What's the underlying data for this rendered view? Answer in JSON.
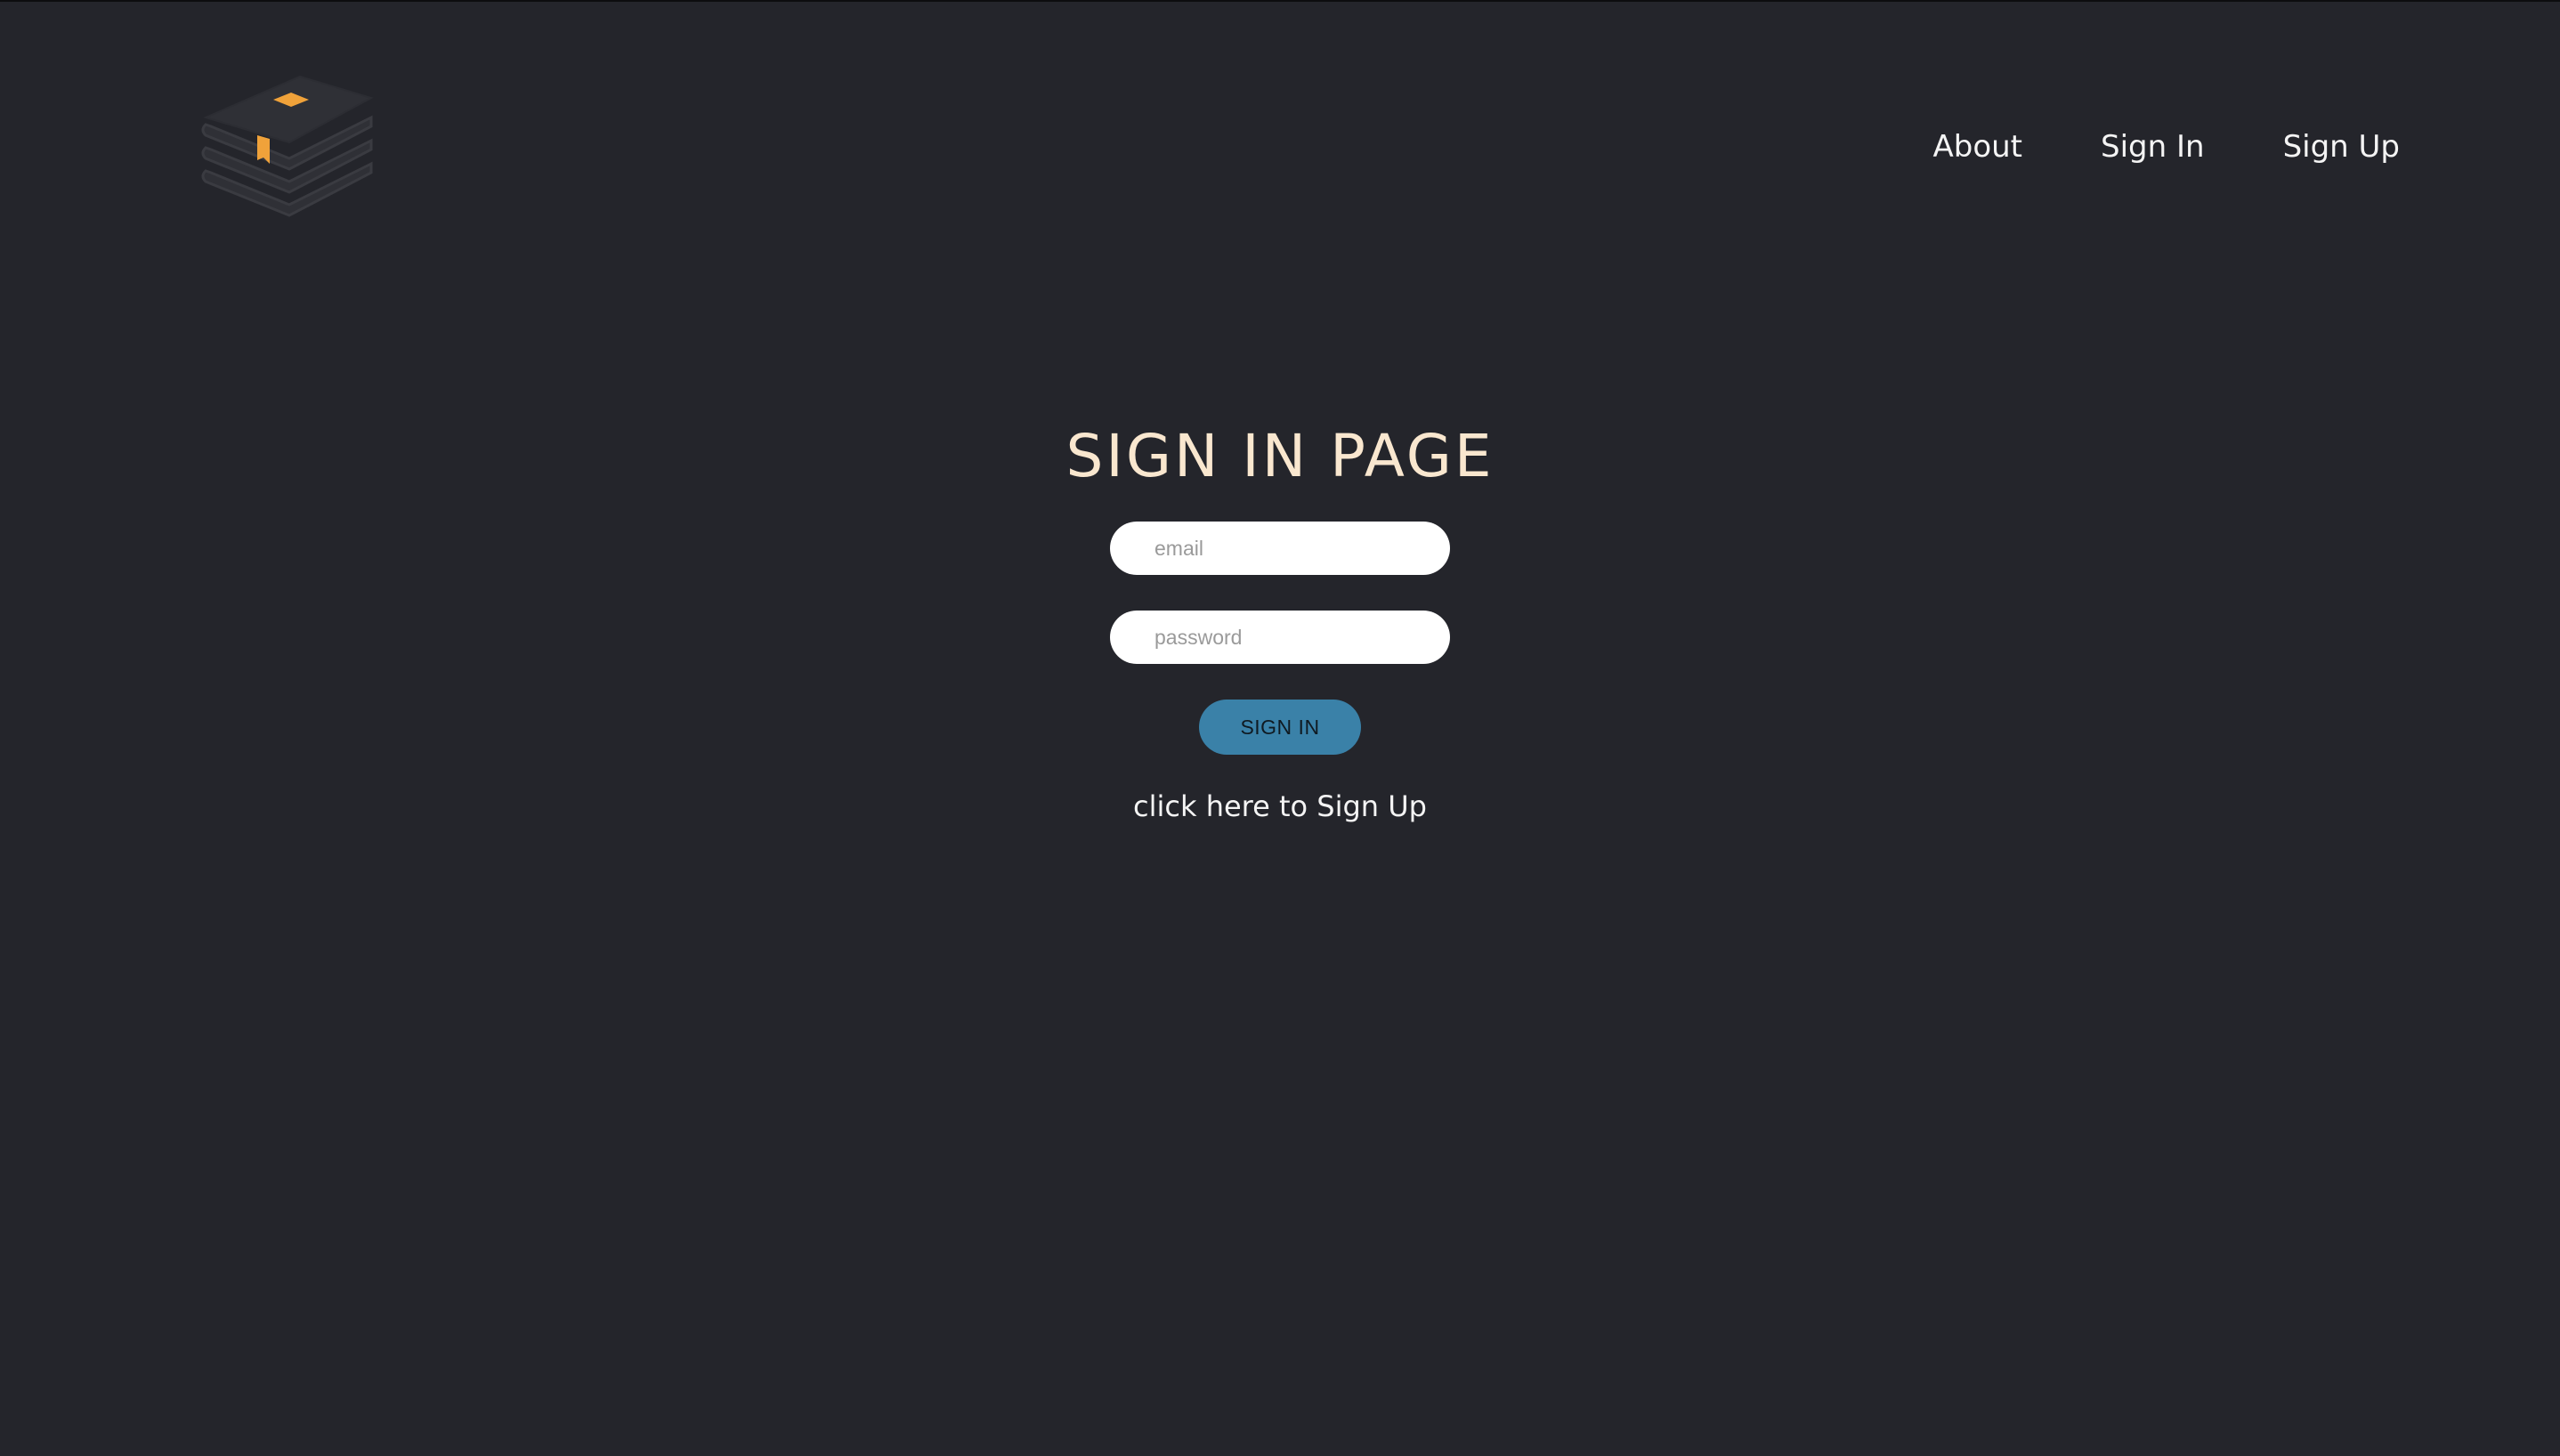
{
  "nav": {
    "items": [
      {
        "label": "About"
      },
      {
        "label": "Sign In"
      },
      {
        "label": "Sign Up"
      }
    ]
  },
  "logo": {
    "icon": "books-stack-icon",
    "accent_color": "#f0a23a",
    "book_color": "#2f3036"
  },
  "main": {
    "title": "SIGN IN PAGE",
    "email": {
      "placeholder": "email",
      "value": ""
    },
    "password": {
      "placeholder": "password",
      "value": ""
    },
    "signin_button": "SIGN IN",
    "signup_link": "click here to Sign Up"
  },
  "colors": {
    "background": "#24252b",
    "title": "#f9e7cf",
    "button": "#3a81a8",
    "text": "#f4f4f4"
  }
}
